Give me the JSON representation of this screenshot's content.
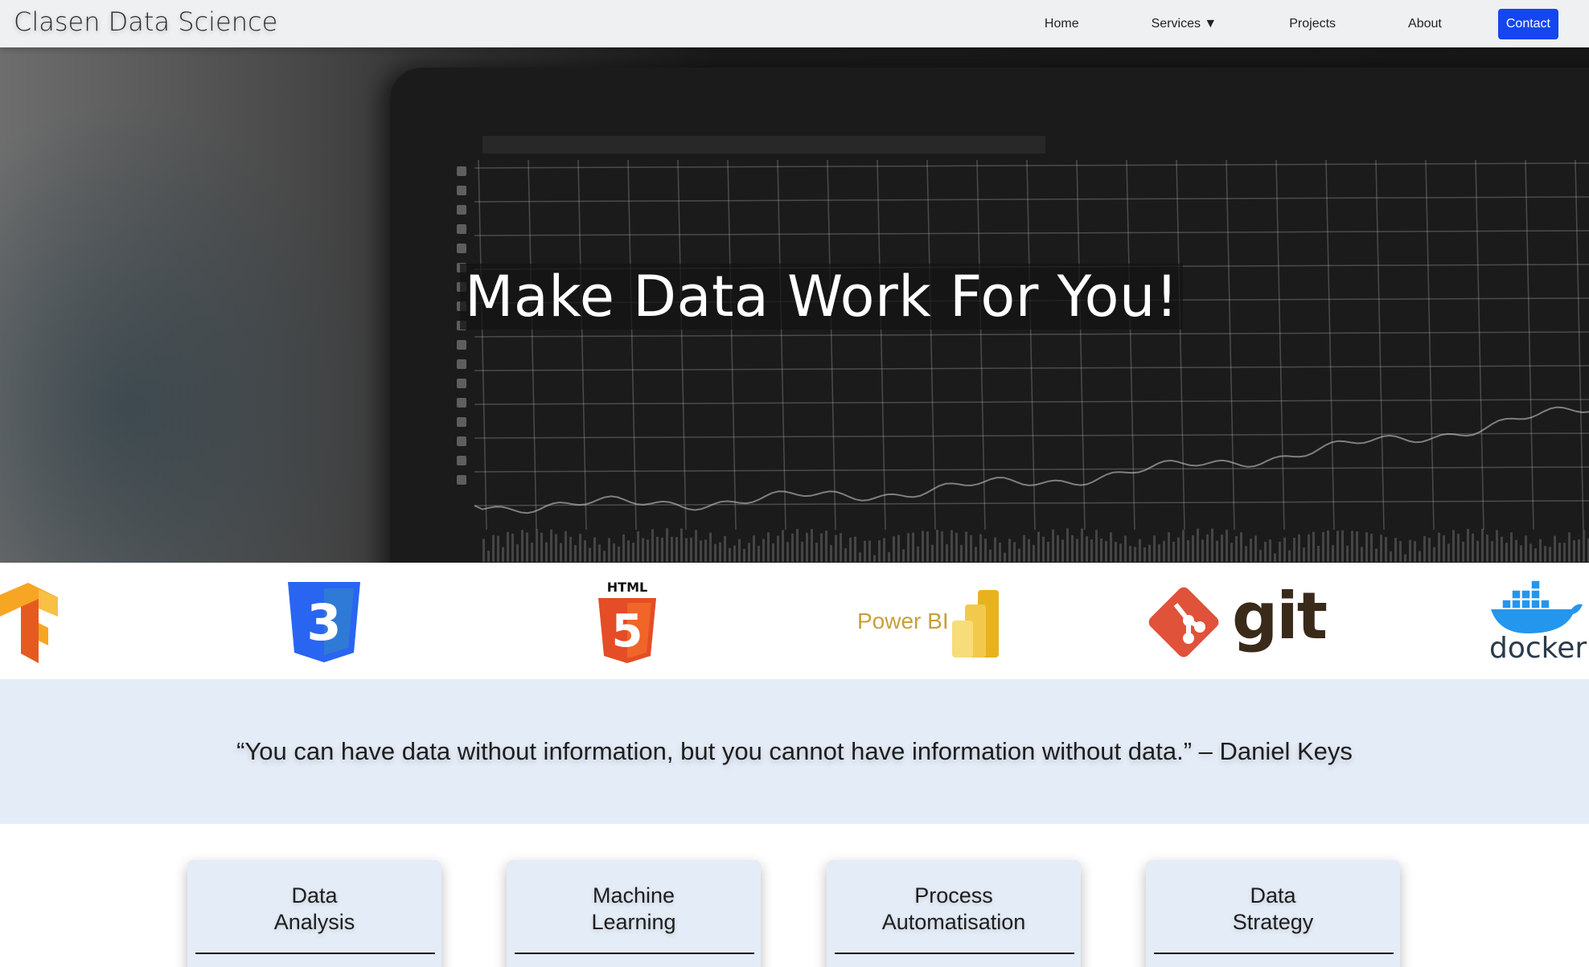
{
  "nav": {
    "brand": "Clasen Data Science",
    "links": [
      {
        "label": "Home"
      },
      {
        "label": "Services ▼"
      },
      {
        "label": "Projects"
      },
      {
        "label": "About"
      }
    ],
    "contact_label": "Contact",
    "contact_color": "#1546f0"
  },
  "hero": {
    "title": "Make Data Work For You!"
  },
  "logos": [
    {
      "name": "tensorflow-logo"
    },
    {
      "name": "css3-logo",
      "text": "3"
    },
    {
      "name": "html5-logo",
      "text": "HTML",
      "badge": "5"
    },
    {
      "name": "power-bi-logo",
      "text": "Power BI"
    },
    {
      "name": "git-logo",
      "text": "git"
    },
    {
      "name": "docker-logo",
      "text": "docker"
    }
  ],
  "quote": {
    "text": "“You can have data without information, but you cannot have information without data.” – Daniel Keys"
  },
  "services": [
    {
      "title": "Data\nAnalysis"
    },
    {
      "title": "Machine\nLearning"
    },
    {
      "title": "Process\nAutomatisation"
    },
    {
      "title": "Data\nStrategy"
    }
  ],
  "colors": {
    "quote_background": "#e4ecf7",
    "card_background": "#e4ecf7"
  }
}
